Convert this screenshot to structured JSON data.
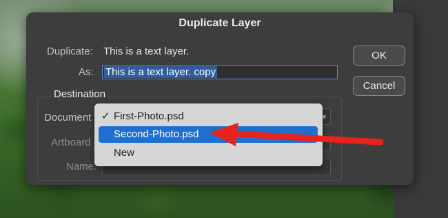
{
  "dialog": {
    "title": "Duplicate Layer",
    "duplicate_label": "Duplicate:",
    "duplicate_value": "This is a text layer.",
    "as_label": "As:",
    "as_value": "This is a text layer. copy",
    "ok_label": "OK",
    "cancel_label": "Cancel"
  },
  "destination": {
    "title": "Destination",
    "document_label": "Document",
    "artboard_label": "Artboard",
    "name_label": "Name:"
  },
  "dropdown": {
    "options": [
      {
        "label": "First-Photo.psd",
        "checked": true
      },
      {
        "label": "Second-Photo.psd",
        "highlighted": true
      },
      {
        "label": "New"
      }
    ]
  },
  "colors": {
    "highlight": "#1f6fd0",
    "arrow": "#e8231c"
  }
}
